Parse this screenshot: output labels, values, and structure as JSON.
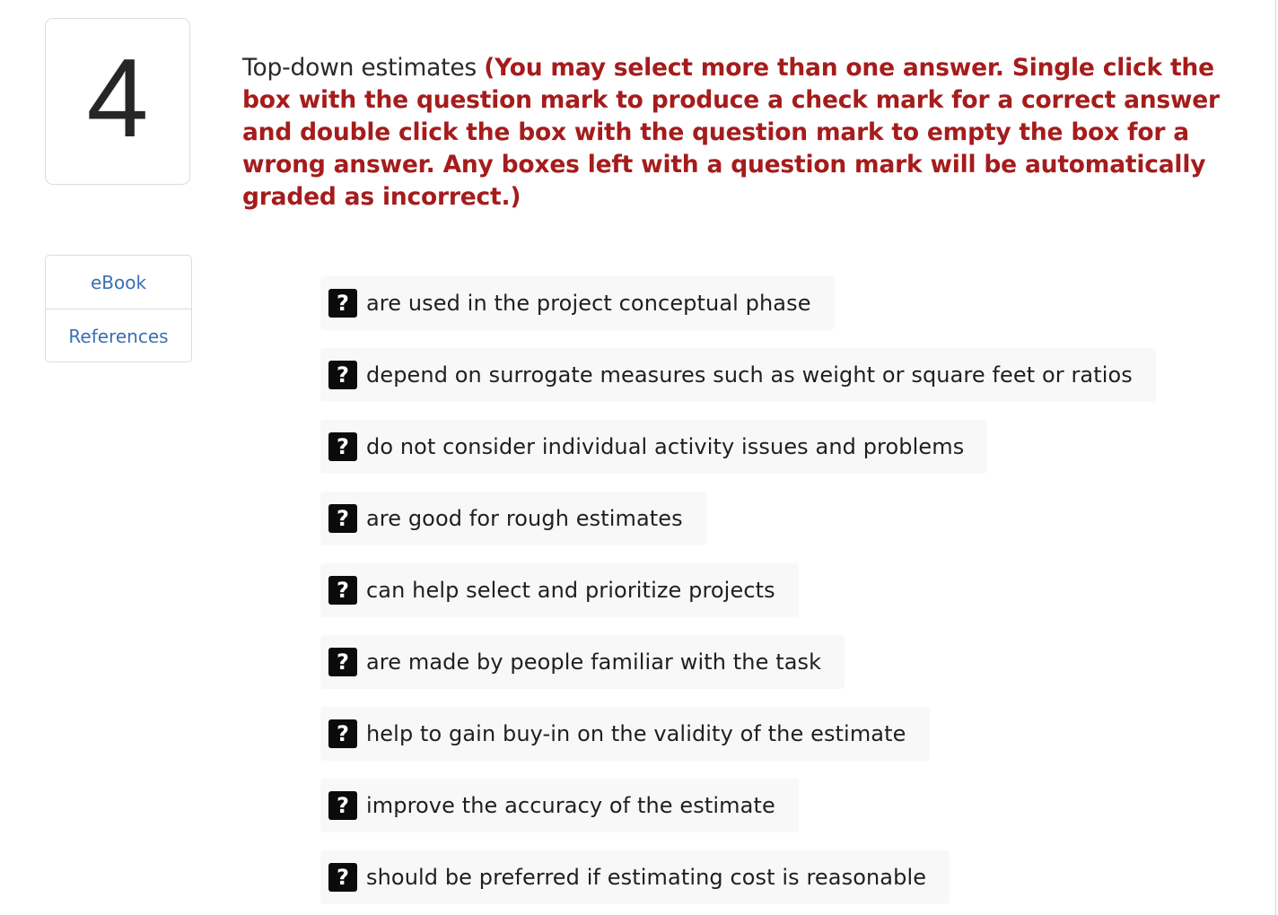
{
  "question": {
    "number": "4",
    "stem": "Top-down estimates ",
    "instructions": "(You may select more than one answer. Single click the box with the question mark to produce a check mark for a correct answer and double click the box with the question mark to empty the box for a wrong answer. Any boxes left with a question mark will be automatically graded as incorrect.)"
  },
  "sidebar": {
    "links": [
      {
        "label": "eBook"
      },
      {
        "label": "References"
      }
    ]
  },
  "answer_box_symbol": "?",
  "answers": [
    {
      "text": "are used in the project conceptual phase"
    },
    {
      "text": "depend on surrogate measures such as weight or square feet or ratios"
    },
    {
      "text": "do not consider individual activity issues and problems"
    },
    {
      "text": "are good for rough estimates"
    },
    {
      "text": "can help select and prioritize projects"
    },
    {
      "text": "are made by people familiar with the task"
    },
    {
      "text": "help to gain buy-in on the validity of the estimate"
    },
    {
      "text": "improve the accuracy of the estimate"
    },
    {
      "text": "should be preferred if estimating cost is reasonable"
    }
  ],
  "colors": {
    "instructions": "#a51c1c",
    "link": "#3a6fb4",
    "answer_background": "#f8f8f8",
    "checkbox": "#0b0b0b"
  }
}
